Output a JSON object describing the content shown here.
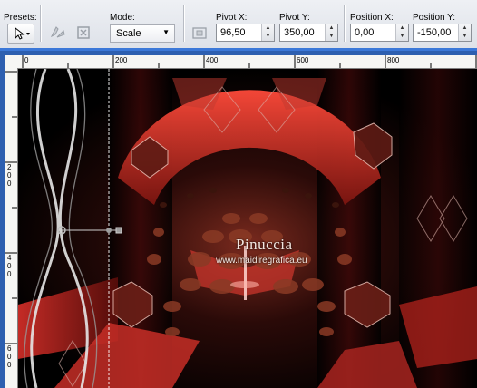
{
  "toolbar": {
    "presets_label": "Presets:",
    "mode_label": "Mode:",
    "mode_value": "Scale",
    "pivot_x_label": "Pivot X:",
    "pivot_x_value": "96,50",
    "pivot_y_label": "Pivot Y:",
    "pivot_y_value": "350,00",
    "position_x_label": "Position X:",
    "position_x_value": "0,00",
    "position_y_label": "Position Y:",
    "position_y_value": "-150,00"
  },
  "ruler": {
    "top_ticks": [
      "0",
      "200",
      "400",
      "600",
      "800"
    ],
    "left_ticks": [
      "2",
      "0",
      "0",
      "4",
      "0",
      "0",
      "6",
      "0",
      "0"
    ]
  },
  "canvas": {
    "watermark_title": "Pinuccia",
    "watermark_url": "www.maidiregrafica.eu"
  },
  "icons": {
    "preset": "pointer-icon",
    "flip": "flip-icon",
    "rotate": "rotate-icon",
    "pivot": "pivot-icon"
  },
  "colors": {
    "accent": "#3b78d8",
    "frame": "#2d5fb0",
    "red": "#e0302a"
  }
}
